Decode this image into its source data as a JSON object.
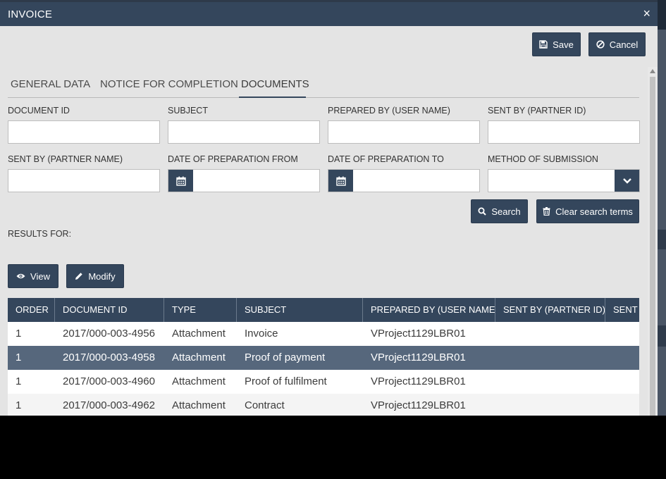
{
  "dialog": {
    "title": "INVOICE",
    "close_label": "×"
  },
  "actions": {
    "save_label": "Save",
    "cancel_label": "Cancel"
  },
  "tabs": [
    {
      "label": "GENERAL DATA",
      "active": false
    },
    {
      "label": "NOTICE FOR COMPLETION",
      "active": false
    },
    {
      "label": "DOCUMENTS",
      "active": true
    }
  ],
  "filters": {
    "document_id": {
      "label": "DOCUMENT ID",
      "value": ""
    },
    "subject": {
      "label": "SUBJECT",
      "value": ""
    },
    "prepared_by": {
      "label": "PREPARED BY (USER NAME)",
      "value": ""
    },
    "sent_by_id": {
      "label": "SENT BY (PARTNER ID)",
      "value": ""
    },
    "sent_by_name": {
      "label": "SENT BY (PARTNER NAME)",
      "value": ""
    },
    "date_from": {
      "label": "DATE OF PREPARATION FROM",
      "value": ""
    },
    "date_to": {
      "label": "DATE OF PREPARATION TO",
      "value": ""
    },
    "method": {
      "label": "METHOD OF SUBMISSION",
      "value": ""
    }
  },
  "search": {
    "search_label": "Search",
    "clear_label": "Clear search terms",
    "results_label": "RESULTS FOR:"
  },
  "grid_actions": {
    "view_label": "View",
    "modify_label": "Modify"
  },
  "table": {
    "columns": [
      "ORDER",
      "DOCUMENT ID",
      "TYPE",
      "SUBJECT",
      "PREPARED BY (USER NAME)",
      "SENT BY (PARTNER ID)",
      "SENT BY (PARTNER NAME)"
    ],
    "rows": [
      [
        "1",
        "2017/000-003-4956",
        "Attachment",
        "Invoice",
        "VProject1129LBR01",
        "",
        ""
      ],
      [
        "1",
        "2017/000-003-4958",
        "Attachment",
        "Proof of payment",
        "VProject1129LBR01",
        "",
        ""
      ],
      [
        "1",
        "2017/000-003-4960",
        "Attachment",
        "Proof of fulfilment",
        "VProject1129LBR01",
        "",
        ""
      ],
      [
        "1",
        "2017/000-003-4962",
        "Attachment",
        "Contract",
        "VProject1129LBR01",
        "",
        ""
      ]
    ],
    "selected_row": 1
  },
  "colors": {
    "primary": "#34465c",
    "selected_row": "#56677c",
    "panel": "#e4e4e4"
  }
}
